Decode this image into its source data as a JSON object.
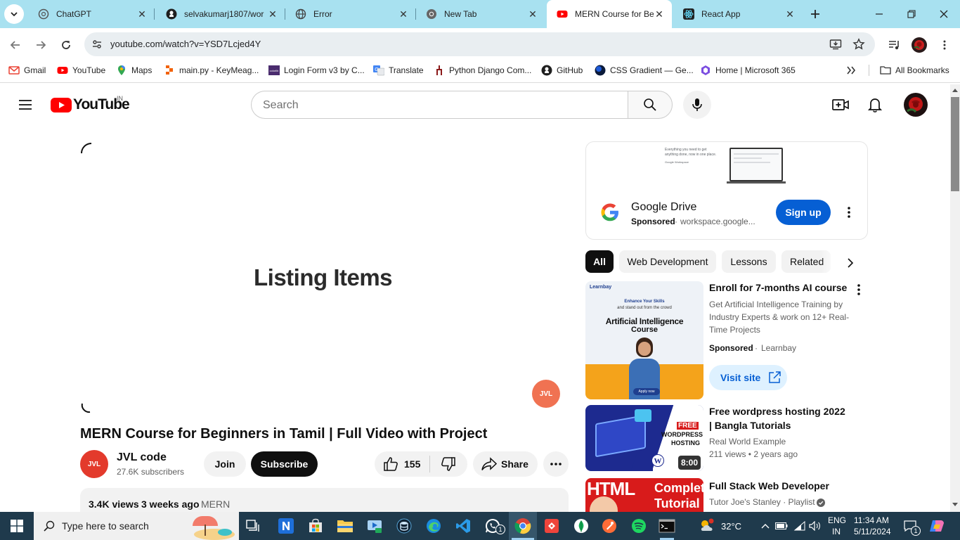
{
  "browser": {
    "tabs": [
      {
        "label": "ChatGPT",
        "icon": "chatgpt-icon"
      },
      {
        "label": "selvakumarj1807/wor",
        "icon": "github-icon"
      },
      {
        "label": "Error",
        "icon": "globe-icon"
      },
      {
        "label": "New Tab",
        "icon": "chrome-icon"
      },
      {
        "label": "MERN Course for Beg",
        "icon": "youtube-icon",
        "active": true
      },
      {
        "label": "React App",
        "icon": "react-icon"
      }
    ],
    "url": "youtube.com/watch?v=YSD7Lcjed4Y",
    "bookmarks": [
      {
        "label": "Gmail",
        "icon": "gmail-icon"
      },
      {
        "label": "YouTube",
        "icon": "youtube-icon"
      },
      {
        "label": "Maps",
        "icon": "maps-icon"
      },
      {
        "label": "main.py - KeyMeag...",
        "icon": "replit-icon"
      },
      {
        "label": "Login Form v3 by C...",
        "icon": "colorlib-icon"
      },
      {
        "label": "Translate",
        "icon": "translate-icon"
      },
      {
        "label": "Python Django Com...",
        "icon": "django-icon"
      },
      {
        "label": "GitHub",
        "icon": "github-icon"
      },
      {
        "label": "CSS Gradient — Ge...",
        "icon": "cssgradient-icon"
      },
      {
        "label": "Home | Microsoft 365",
        "icon": "m365-icon"
      }
    ],
    "all_bookmarks": "All Bookmarks"
  },
  "youtube": {
    "logo_text": "YouTube",
    "country": "IN",
    "search_placeholder": "Search",
    "player_text": "Listing Items",
    "video_title": "MERN Course for Beginners in Tamil | Full Video with Project",
    "channel": {
      "name": "JVL code",
      "subscribers": "27.6K subscribers",
      "avatar_text": "JVL"
    },
    "join_label": "Join",
    "subscribe_label": "Subscribe",
    "likes": "155",
    "share_label": "Share",
    "description": {
      "views": "3.4K views",
      "age": "3 weeks ago",
      "tag": "MERN"
    },
    "ad": {
      "banner_line1": "Everything you need to get",
      "banner_line2": "anything done, now in one place.",
      "banner_brand": "Google Workspace",
      "title": "Google Drive",
      "sponsored": "Sponsored",
      "domain": "workspace.google...",
      "cta": "Sign up"
    },
    "chips": [
      "All",
      "Web Development",
      "Lessons",
      "Related"
    ],
    "recommendations": [
      {
        "title": "Enroll for 7-months AI course",
        "description": "Get Artificial Intelligence Training by Industry Experts & work on 12+ Real-Time Projects",
        "sponsored": "Sponsored",
        "advertiser": "Learnbay",
        "cta": "Visit site",
        "thumb_brand": "Learnbay",
        "thumb_line1": "Enhance Your Skills",
        "thumb_line2": "and stand out from the crowd",
        "thumb_big1": "Artificial Intelligence",
        "thumb_big2": "Course",
        "thumb_btn": "Apply now"
      },
      {
        "title": "Free wordpress hosting 2022 | Bangla Tutorials",
        "channel": "Real World Example",
        "stats": "211 views • 2 years ago",
        "duration": "8:00",
        "thumb_free": "FREE",
        "thumb_line1": "WORDPRESS",
        "thumb_line2": "HOSTING"
      },
      {
        "title": "Full Stack Web Developer",
        "channel": "Tutor Joe's Stanley · Playlist",
        "thumb_html": "HTML",
        "thumb_complete": "Complete",
        "thumb_tutorial": "Tutorial"
      }
    ]
  },
  "taskbar": {
    "search_placeholder": "Type here to search",
    "weather": "32°C",
    "language_line1": "ENG",
    "language_line2": "IN",
    "time": "11:34 AM",
    "date": "5/11/2024",
    "notification_count": "1",
    "whatsapp_badge": "1"
  },
  "colors": {
    "tabstrip": "#a8e1f0",
    "youtube_red": "#ff0000",
    "signup_blue": "#065fd4",
    "taskbar": "#1f3a4c"
  }
}
